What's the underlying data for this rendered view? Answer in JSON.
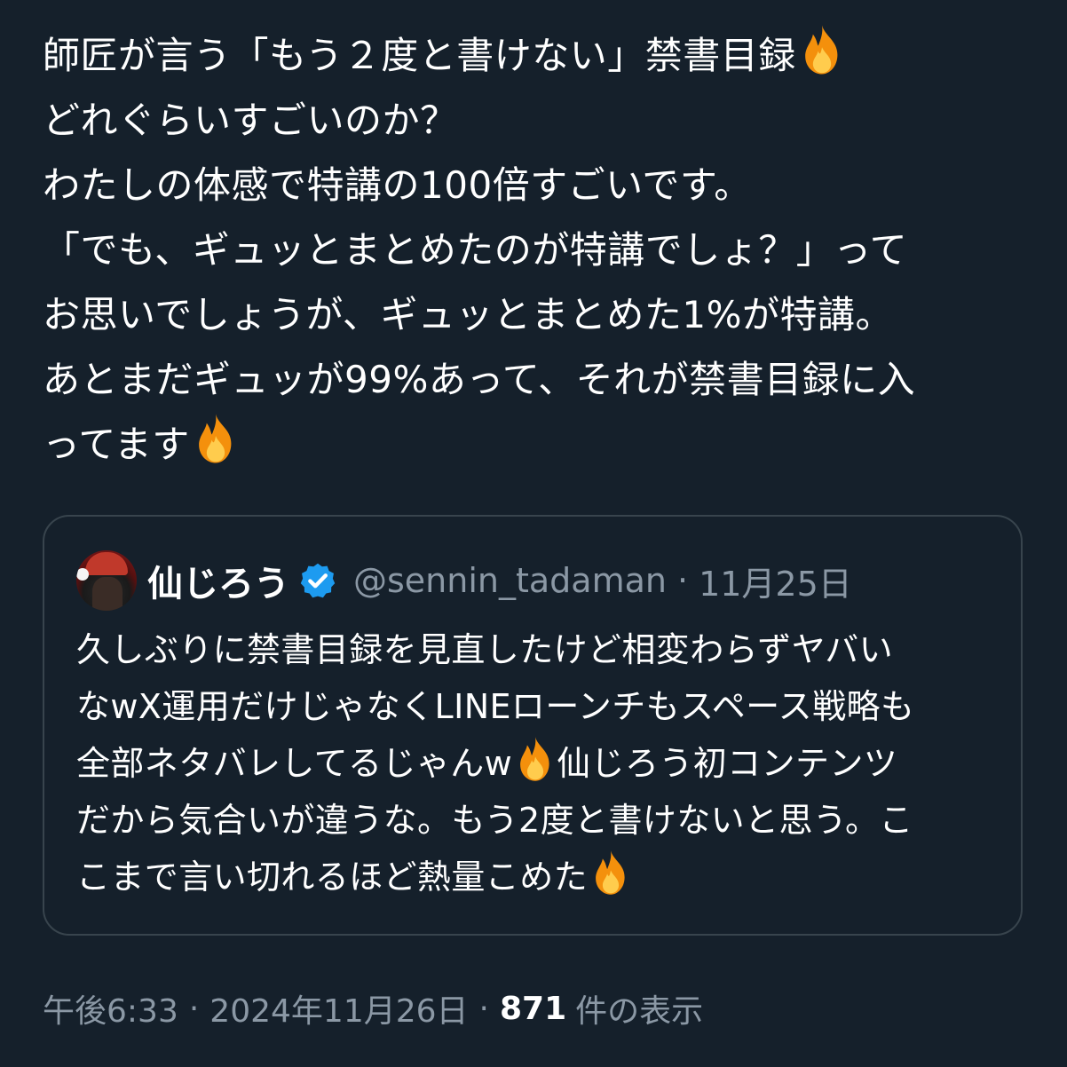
{
  "tweet": {
    "lines": [
      "師匠が言う「もう２度と書けない」禁書目録",
      "どれぐらいすごいのか？",
      "わたしの体感で特講の100倍すごいです。",
      "「でも、ギュッとまとめたのが特講でしょ？」って",
      "お思いでしょうが、ギュッとまとめた1%が特講。",
      "あとまだギュッが99%あって、それが禁書目録に入",
      "ってます"
    ]
  },
  "quote": {
    "name": "仙じろう",
    "handle": "@sennin_tadaman",
    "separator": "·",
    "date": "11月25日",
    "lines": [
      "久しぶりに禁書目録を見直したけど相変わらずヤバい",
      "なwX運用だけじゃなくLINEローンチもスペース戦略も",
      "全部ネタバレしてるじゃんw",
      "仙じろう初コンテンツ",
      "だから気合いが違うな。もう2度と書けないと思う。こ",
      "こまで言い切れるほど熱量こめた"
    ]
  },
  "meta": {
    "time": "午後6:33",
    "separator1": "·",
    "date": "2024年11月26日",
    "separator2": "·",
    "views_count": "871",
    "views_label": "件の表示"
  },
  "icons": {
    "fire": "fire-emoji-icon",
    "verified": "verified-badge-icon",
    "verified_color": "#1d9bf0",
    "fire_outer": "#f4900c",
    "fire_inner": "#ffcc4d"
  },
  "colors": {
    "background": "#15202b",
    "text": "#ffffff",
    "muted": "#8b98a5",
    "border": "#38444d"
  }
}
